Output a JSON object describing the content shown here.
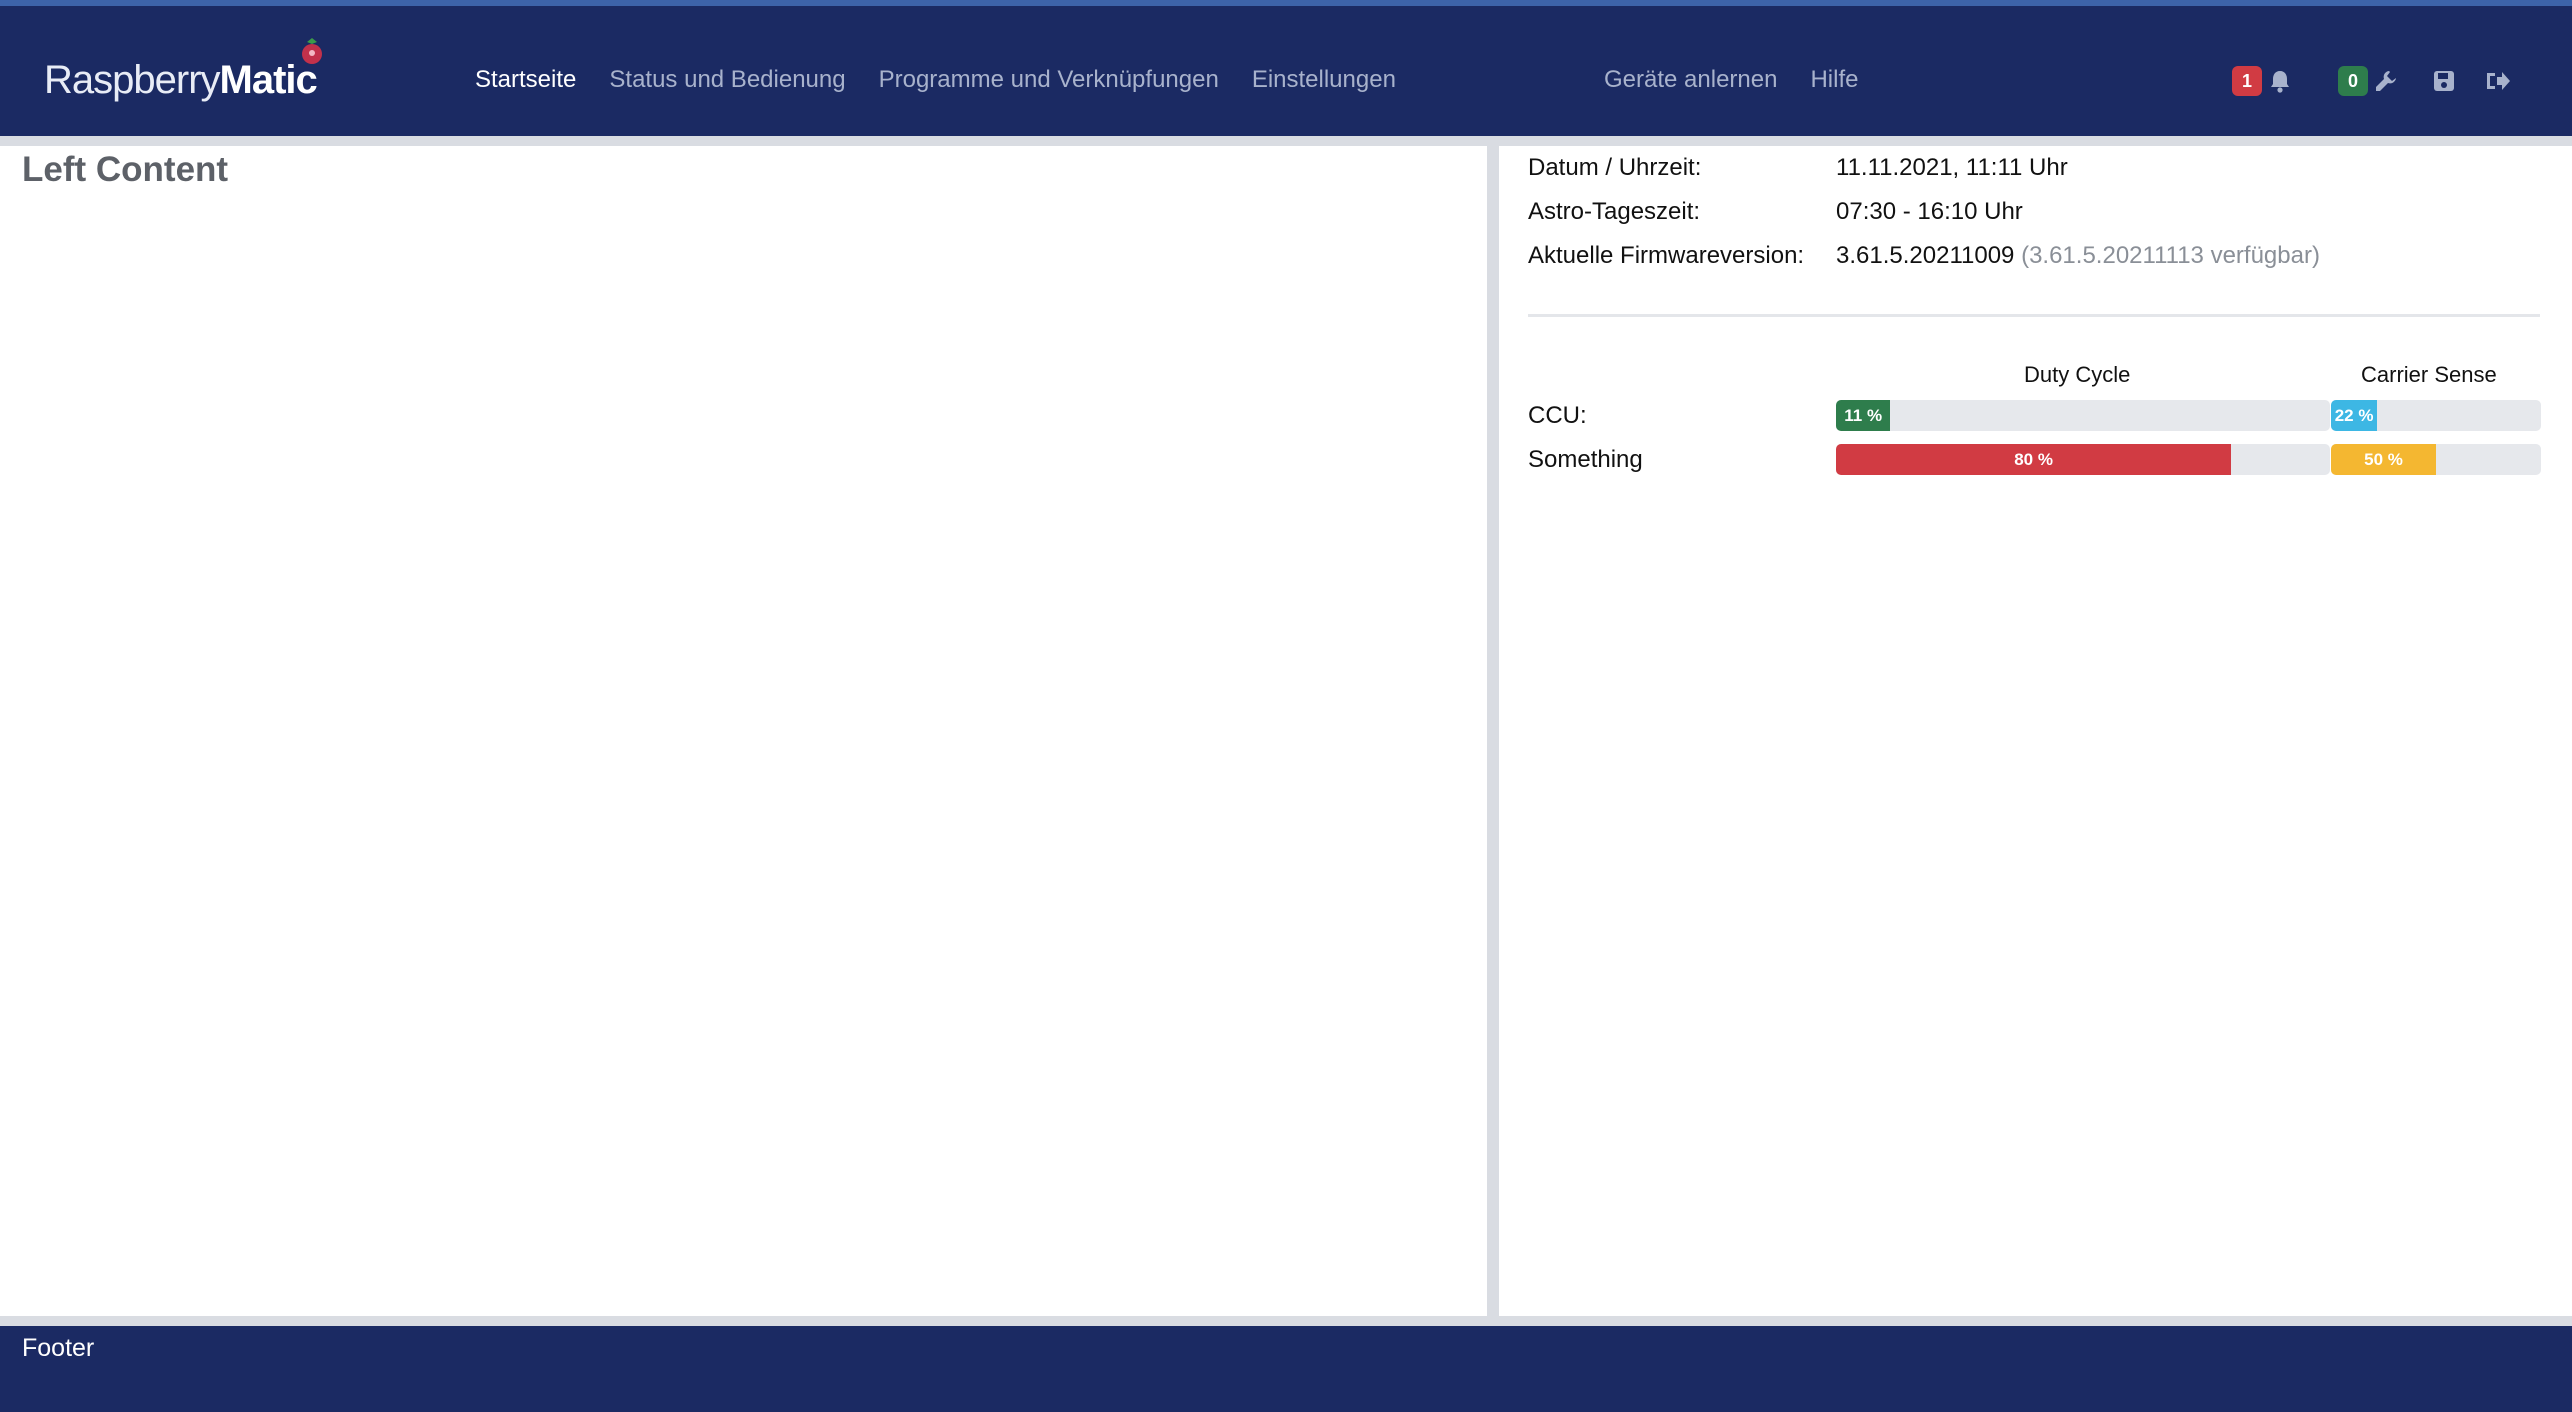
{
  "brand": {
    "part1": "Raspberry",
    "part2": "Matic"
  },
  "nav": {
    "startseite": "Startseite",
    "status": "Status und Bedienung",
    "programme": "Programme und Verknüpfungen",
    "einstellungen": "Einstellungen",
    "geraete": "Geräte anlernen",
    "hilfe": "Hilfe"
  },
  "badges": {
    "alarms": "1",
    "service": "0"
  },
  "icons": {
    "alarm": "bell-icon",
    "service": "wrench-icon",
    "save": "save-icon",
    "logout": "logout-icon"
  },
  "left": {
    "title": "Left Content"
  },
  "info": {
    "datetime_label": "Datum / Uhrzeit:",
    "datetime_value": "11.11.2021, 11:11 Uhr",
    "astro_label": "Astro-Tageszeit:",
    "astro_value": "07:30 - 16:10 Uhr",
    "fw_label": "Aktuelle Firmwareversion:",
    "fw_value": "3.61.5.20211009",
    "fw_available": "(3.61.5.20211113 verfügbar)"
  },
  "load": {
    "duty_header": "Duty Cycle",
    "carrier_header": "Carrier Sense",
    "rows": [
      {
        "label": "CCU:",
        "duty_text": "11 %",
        "duty": 0.11,
        "duty_color": "#2e7d4c",
        "carrier_text": "22 %",
        "carrier": 0.22,
        "carrier_color": "#3db7e4"
      },
      {
        "label": "Something",
        "duty_text": "80 %",
        "duty": 0.8,
        "duty_color": "#d13b43",
        "carrier_text": "50 %",
        "carrier": 0.5,
        "carrier_color": "#f4b731"
      }
    ]
  },
  "footer": {
    "text": "Footer"
  }
}
